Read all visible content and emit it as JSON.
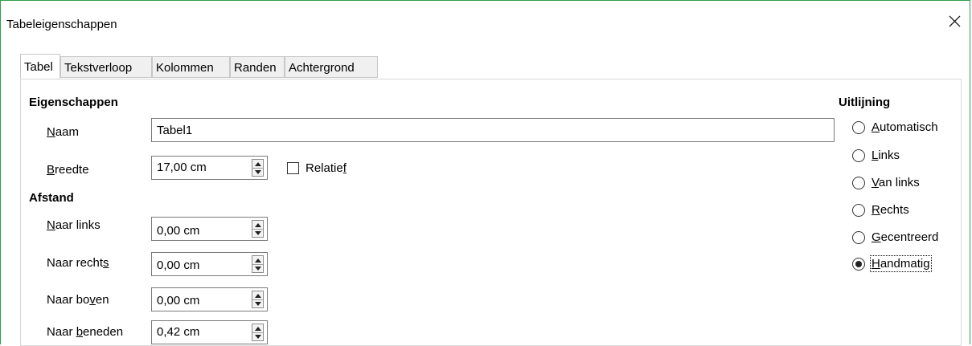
{
  "window": {
    "title": "Tabeleigenschappen",
    "accent_color": "#2e9e4a"
  },
  "tabs": [
    "Tabel",
    "Tekstverloop",
    "Kolommen",
    "Randen",
    "Achtergrond"
  ],
  "active_tab": "Tabel",
  "eigenschappen": {
    "heading": "Eigenschappen",
    "naam": {
      "label_pre": "",
      "label_key": "N",
      "label_post": "aam",
      "value": "Tabel1"
    },
    "breedte": {
      "label_pre": "",
      "label_key": "B",
      "label_post": "reedte",
      "value": "17,00 cm"
    },
    "relatief": {
      "label_pre": "Relatie",
      "label_key": "f",
      "label_post": "",
      "checked": false
    }
  },
  "afstand": {
    "heading": "Afstand",
    "naar_links": {
      "label_pre": "",
      "label_key": "N",
      "label_post": "aar links",
      "value": "0,00 cm"
    },
    "naar_rechts": {
      "label_pre": "Naar recht",
      "label_key": "s",
      "label_post": "",
      "value": "0,00 cm"
    },
    "naar_boven": {
      "label_pre": "Naar bo",
      "label_key": "v",
      "label_post": "en",
      "value": "0,00 cm"
    },
    "naar_beneden": {
      "label_pre": "Naar ",
      "label_key": "b",
      "label_post": "eneden",
      "value": "0,42 cm"
    }
  },
  "uitlijning": {
    "heading": "Uitlijning",
    "options": [
      {
        "pre": "",
        "key": "A",
        "post": "utomatisch",
        "checked": false
      },
      {
        "pre": "",
        "key": "L",
        "post": "inks",
        "checked": false
      },
      {
        "pre": "",
        "key": "V",
        "post": "an links",
        "checked": false
      },
      {
        "pre": "",
        "key": "R",
        "post": "echts",
        "checked": false
      },
      {
        "pre": "",
        "key": "G",
        "post": "ecentreerd",
        "checked": false
      },
      {
        "pre": "",
        "key": "H",
        "post": "andmatig",
        "checked": true
      }
    ]
  }
}
